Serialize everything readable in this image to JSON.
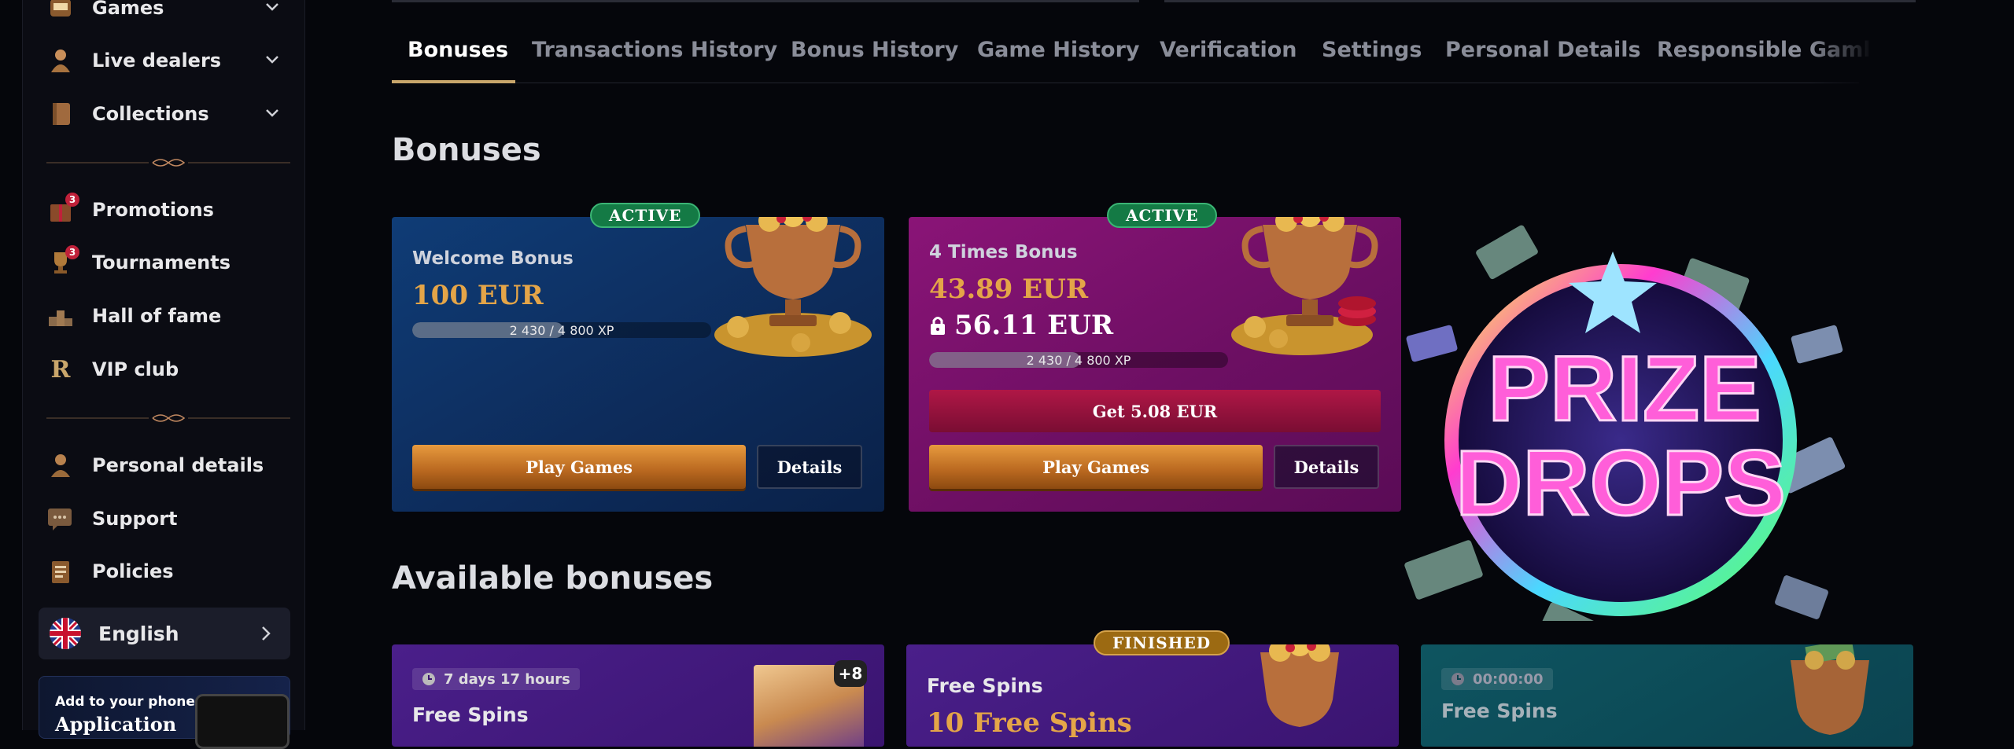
{
  "sidebar": {
    "items": [
      {
        "label": "Games",
        "icon": "slot-machine-icon",
        "expandable": true
      },
      {
        "label": "Live dealers",
        "icon": "dealer-icon",
        "expandable": true
      },
      {
        "label": "Collections",
        "icon": "book-icon",
        "expandable": true
      },
      {
        "label": "Promotions",
        "icon": "gift-box-icon",
        "badge": "3"
      },
      {
        "label": "Tournaments",
        "icon": "trophy-icon",
        "badge": "3"
      },
      {
        "label": "Hall of fame",
        "icon": "podium-icon"
      },
      {
        "label": "VIP club",
        "icon": "vip-r-icon"
      },
      {
        "label": "Personal details",
        "icon": "person-icon"
      },
      {
        "label": "Support",
        "icon": "chat-icon"
      },
      {
        "label": "Policies",
        "icon": "clipboard-icon"
      }
    ],
    "language": {
      "label": "English",
      "icon": "uk-flag-icon"
    },
    "app_promo": {
      "line1": "Add to your phone",
      "line2": "Application"
    }
  },
  "tabs": [
    "Bonuses",
    "Transactions History",
    "Bonus History",
    "Game History",
    "Verification",
    "Settings",
    "Personal Details",
    "Responsible Gaml"
  ],
  "active_tab": "Bonuses",
  "headings": {
    "bonuses": "Bonuses",
    "available": "Available bonuses"
  },
  "active_bonuses": [
    {
      "status": "ACTIVE",
      "label": "Welcome Bonus",
      "amount": "100 EUR",
      "xp_text": "2 430 / 4 800 XP",
      "xp_fraction": 0.506,
      "play": "Play Games",
      "details": "Details"
    },
    {
      "status": "ACTIVE",
      "label": "4 Times Bonus",
      "amount": "43.89 EUR",
      "locked_amount": "56.11 EUR",
      "xp_text": "2 430 / 4 800 XP",
      "xp_fraction": 0.506,
      "get": "Get 5.08 EUR",
      "play": "Play Games",
      "details": "Details"
    }
  ],
  "available_bonuses": [
    {
      "timer": "7 days 17 hours",
      "label": "Free Spins",
      "extra": "+8"
    },
    {
      "status": "FINISHED",
      "label": "Free Spins",
      "amount": "10 Free Spins"
    },
    {
      "timer": "00:00:00",
      "label": "Free Spins"
    }
  ],
  "promo_banner": {
    "line1": "PRIZE",
    "line2": "DROPS"
  },
  "colors": {
    "accent": "#c9a66b",
    "amount": "#e4a548",
    "active_badge": "#147a45",
    "finished_badge": "#9c6a12"
  }
}
